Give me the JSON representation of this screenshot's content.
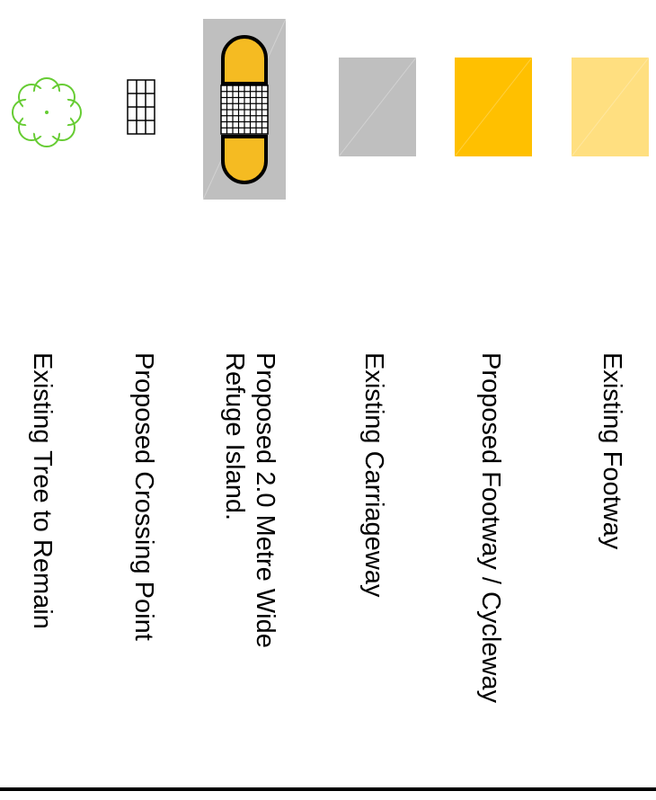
{
  "legend": {
    "items": [
      {
        "id": "existing-footway",
        "label": "Existing Footway",
        "color": "#ffdf80",
        "symbol": "solid-fill"
      },
      {
        "id": "proposed-footway-cycleway",
        "label": "Proposed Footway / Cycleway",
        "color": "#ffc000",
        "symbol": "solid-fill"
      },
      {
        "id": "existing-carriageway",
        "label": "Existing Carriageway",
        "color": "#bfbfbf",
        "symbol": "solid-fill"
      },
      {
        "id": "proposed-refuge-island",
        "label": "Proposed 2.0 Metre Wide\nRefuge Island.",
        "color": "#f5bb22",
        "background": "#bfbfbf",
        "symbol": "refuge-island"
      },
      {
        "id": "proposed-crossing-point",
        "label": "Proposed Crossing Point",
        "color": "#000000",
        "symbol": "grid-icon"
      },
      {
        "id": "existing-tree",
        "label": "Existing Tree to Remain",
        "color": "#66cc33",
        "symbol": "tree-icon"
      }
    ]
  }
}
